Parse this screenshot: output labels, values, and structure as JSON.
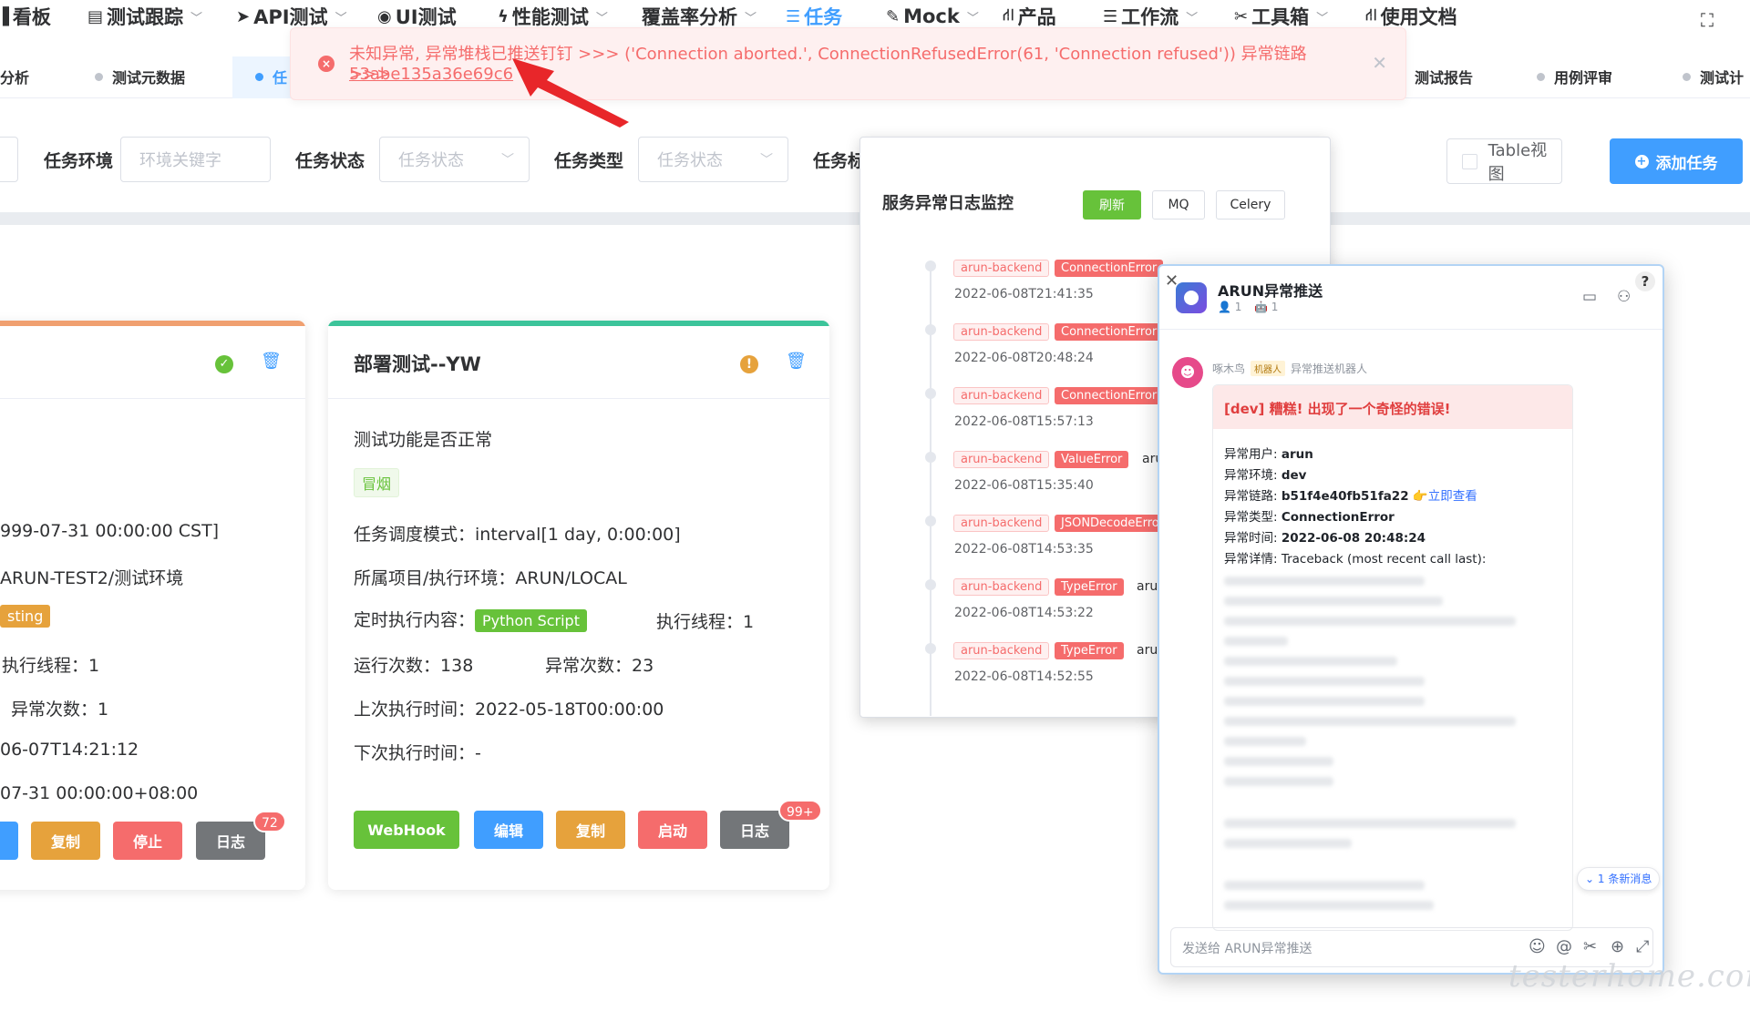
{
  "nav": {
    "items": [
      {
        "label": "看板",
        "icon": "chart-icon",
        "chevron": false
      },
      {
        "label": "测试跟踪",
        "icon": "document-icon",
        "chevron": true
      },
      {
        "label": "API测试",
        "icon": "send-icon",
        "chevron": true
      },
      {
        "label": "UI测试",
        "icon": "compass-icon",
        "chevron": false
      },
      {
        "label": "性能测试",
        "icon": "lightning-icon",
        "chevron": true
      },
      {
        "label": "覆盖率分析",
        "icon": "",
        "chevron": true
      },
      {
        "label": "任务",
        "icon": "list-icon",
        "chevron": false,
        "active": true
      },
      {
        "label": "Mock",
        "icon": "wand-icon",
        "chevron": true
      },
      {
        "label": "产品",
        "icon": "flow-icon",
        "chevron": false
      },
      {
        "label": "工作流",
        "icon": "sliders-icon",
        "chevron": true
      },
      {
        "label": "工具箱",
        "icon": "tools-icon",
        "chevron": true
      },
      {
        "label": "使用文档",
        "icon": "flow-icon",
        "chevron": false
      }
    ]
  },
  "tabs": {
    "items": [
      "分析",
      "测试元数据",
      "任",
      "测试报告",
      "用例评审",
      "测试计"
    ]
  },
  "alert": {
    "message": "未知异常, 异常堆栈已推送钉钉 >>> ('Connection aborted.', ConnectionRefusedError(61, 'Connection refused')) 异常链路 >>>",
    "trace_link": "53abe135a36e69c6"
  },
  "filters": {
    "env_label": "任务环境",
    "env_placeholder": "环境关键字",
    "status_label": "任务状态",
    "status_placeholder": "任务状态",
    "type_label": "任务类型",
    "type_placeholder": "任务状态",
    "extra_label": "任务标",
    "table_view": "Table视图",
    "add_task": "添加任务"
  },
  "card_left": {
    "lines": [
      "999-07-31 00:00:00 CST]",
      "ARUN-TEST2/测试环境",
      "sting",
      "执行线程：1",
      "异常次数：1",
      "06-07T14:21:12",
      "07-31 00:00:00+08:00"
    ],
    "buttons": [
      "复制",
      "停止",
      "日志"
    ],
    "log_badge": "72"
  },
  "card_main": {
    "title": "部署测试--YW",
    "desc": "测试功能是否正常",
    "tag": "冒烟",
    "schedule_label": "任务调度模式：",
    "schedule_value": "interval[1 day, 0:00:00]",
    "project_label": "所属项目/执行环境：",
    "project_value": "ARUN/LOCAL",
    "content_label": "定时执行内容：",
    "content_tag": "Python Script",
    "threads_label": "执行线程：",
    "threads_value": "1",
    "runs_label": "运行次数：",
    "runs_value": "138",
    "errors_label": "异常次数：",
    "errors_value": "23",
    "last_label": "上次执行时间：",
    "last_value": "2022-05-18T00:00:00",
    "next_label": "下次执行时间：",
    "next_value": "-",
    "buttons": [
      "WebHook",
      "编辑",
      "复制",
      "启动",
      "日志"
    ],
    "log_badge": "99+"
  },
  "log_panel": {
    "title": "服务异常日志监控",
    "refresh": "刷新",
    "mq": "MQ",
    "celery": "Celery",
    "entries": [
      {
        "service": "arun-backend",
        "error": "ConnectionError",
        "user": "",
        "time": "2022-06-08T21:41:35"
      },
      {
        "service": "arun-backend",
        "error": "ConnectionError",
        "user": "",
        "time": "2022-06-08T20:48:24"
      },
      {
        "service": "arun-backend",
        "error": "ConnectionError",
        "user": "",
        "time": "2022-06-08T15:57:13"
      },
      {
        "service": "arun-backend",
        "error": "ValueError",
        "user": "aru",
        "time": "2022-06-08T15:35:40"
      },
      {
        "service": "arun-backend",
        "error": "JSONDecodeErro",
        "user": "",
        "time": "2022-06-08T14:53:35"
      },
      {
        "service": "arun-backend",
        "error": "TypeError",
        "user": "aru",
        "time": "2022-06-08T14:53:22"
      },
      {
        "service": "arun-backend",
        "error": "TypeError",
        "user": "aru",
        "time": "2022-06-08T14:52:55"
      }
    ]
  },
  "dingtalk": {
    "group_name": "ARUN异常推送",
    "members": "1",
    "bots": "1",
    "sender": "啄木鸟",
    "robot_tag": "机器人",
    "sender_desc": "异常推送机器人",
    "msg_title": "[dev] 糟糕! 出现了一个奇怪的错误!",
    "user_label": "异常用户: ",
    "user_value": "arun",
    "env_label": "异常环境: ",
    "env_value": "dev",
    "trace_label": "异常链路: ",
    "trace_value": "b51f4e40fb51fa22",
    "trace_link": "立即查看",
    "type_label": "异常类型: ",
    "type_value": "ConnectionError",
    "time_label": "异常时间: ",
    "time_value": "2022-06-08 20:48:24",
    "detail_label": "异常详情: ",
    "detail_value": "Traceback (most recent call last):",
    "new_msg": "1 条新消息",
    "input_placeholder": "发送给 ARUN异常推送"
  },
  "watermark": "testerhome.com",
  "colors": {
    "primary": "#409eff",
    "danger": "#f56c6c",
    "success": "#67c23a",
    "warning": "#e6a23c"
  }
}
